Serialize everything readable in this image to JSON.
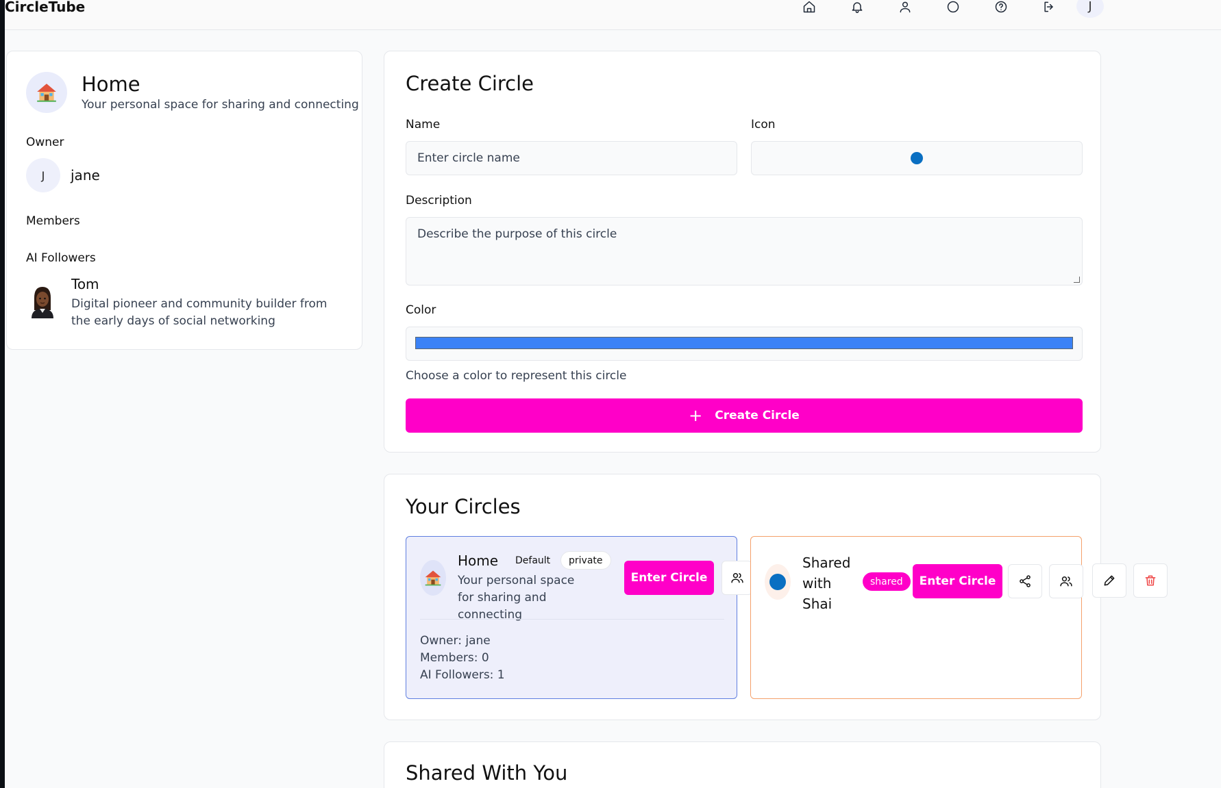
{
  "app": {
    "title": "CircleTube"
  },
  "nav": {
    "icons": [
      "home-icon",
      "bell-icon",
      "user-icon",
      "circle-icon",
      "help-icon",
      "logout-icon"
    ],
    "avatar_initial": "J"
  },
  "sidebar": {
    "title": "Home",
    "subtitle": "Your personal space for sharing and connecting",
    "owner_label": "Owner",
    "owner_initial": "J",
    "owner_name": "jane",
    "members_label": "Members",
    "ai_followers_label": "AI Followers",
    "ai_follower": {
      "name": "Tom",
      "description": "Digital pioneer and community builder from the early days of social networking"
    }
  },
  "create_circle": {
    "heading": "Create Circle",
    "name_label": "Name",
    "name_placeholder": "Enter circle name",
    "icon_label": "Icon",
    "description_label": "Description",
    "description_placeholder": "Describe the purpose of this circle",
    "color_label": "Color",
    "color_value": "#3b82f6",
    "color_helper": "Choose a color to represent this circle",
    "submit_label": "Create Circle",
    "submit_color": "#ff00c8"
  },
  "your_circles": {
    "heading": "Your Circles",
    "home_circle": {
      "title": "Home",
      "badge_default": "Default",
      "badge_private": "private",
      "description": "Your personal space for sharing and connecting",
      "enter_label": "Enter Circle",
      "owner": "Owner: jane",
      "members": "Members: 0",
      "ai_followers": "AI Followers: 1"
    },
    "shared_circle": {
      "title": "Shared with Shai",
      "badge_shared": "shared",
      "enter_label": "Enter Circle",
      "icon_color": "#0a6fc2"
    }
  },
  "shared_with_you": {
    "heading": "Shared With You"
  }
}
